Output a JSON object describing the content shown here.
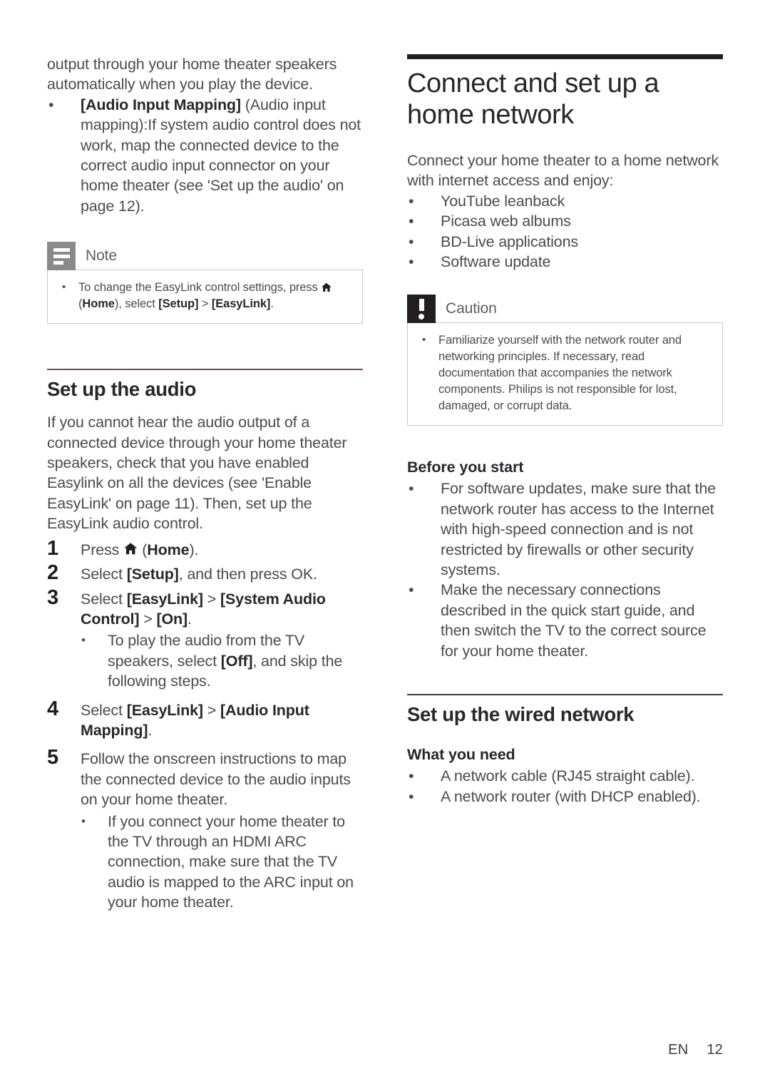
{
  "left_column": {
    "continued_paragraph": "output through your home theater speakers automatically when you play the device.",
    "bullet_audio_input_mapping": {
      "bold_label": "[Audio Input Mapping]",
      "rest": " (Audio input mapping):If system audio control does not work, map the connected device to the correct audio input connector on your home theater (see 'Set up the audio' on page 12)."
    },
    "note_box": {
      "title": "Note",
      "icon": "note-lines-icon",
      "bullet_part1": "To change the EasyLink control settings, press ",
      "bullet_icon": "home-icon",
      "bullet_part2": " (",
      "bullet_home_bold": "Home",
      "bullet_part3": "), select ",
      "bullet_setup_bold": "[Setup]",
      "bullet_part4": " > ",
      "bullet_easylink_bold": "[EasyLink]",
      "bullet_part5": "."
    },
    "section": {
      "heading": "Set up the audio",
      "intro": "If you cannot hear the audio output of a connected device through your home theater speakers, check that you have enabled Easylink on all the devices (see 'Enable EasyLink' on page 11). Then, set up the EasyLink audio control."
    },
    "steps": [
      {
        "number": "1",
        "pre": "Press ",
        "icon": "home-icon",
        "bold": "Home",
        "mid": " (",
        "post": ")."
      },
      {
        "number": "2",
        "pre": "Select ",
        "bold": "[Setup]",
        "post": ", and then press OK."
      },
      {
        "number": "3",
        "pre": "Select ",
        "bold": "[EasyLink]",
        "mid": " > ",
        "bold2": "[System Audio Control]",
        "mid2": " > ",
        "bold3": "[On]",
        "post": ".",
        "subbullet": {
          "pre": "To play the audio from the TV speakers, select ",
          "bold": "[Off]",
          "post": ", and skip the following steps."
        }
      },
      {
        "number": "4",
        "pre": "Select ",
        "bold": "[EasyLink]",
        "mid": " > ",
        "bold2": "[Audio Input Mapping]",
        "post": "."
      },
      {
        "number": "5",
        "pre": "Follow the onscreen instructions to map the connected device to the audio inputs on your home theater.",
        "subbullet": {
          "pre": "If you connect your home theater to the TV through an HDMI ARC connection, make sure that the TV audio is mapped to the ARC input on your home theater."
        }
      }
    ]
  },
  "right_column": {
    "title": "Connect and set up a home network",
    "intro": "Connect your home theater to a home network with internet access and enjoy:",
    "feature_bullets": [
      "YouTube leanback",
      "Picasa web albums",
      "BD-Live applications",
      "Software update"
    ],
    "caution_box": {
      "title": "Caution",
      "icon": "exclamation-icon",
      "bullet": "Familiarize yourself with the network router and networking principles. If necessary, read documentation that accompanies the network components. Philips is not responsible for lost, damaged, or corrupt data."
    },
    "before_you_start": {
      "heading": "Before you start",
      "bullets": [
        "For software updates, make sure that the network router has access to the Internet with high-speed connection and is not restricted by firewalls or other security systems.",
        "Make the necessary connections described in the quick start guide, and then switch the TV to the correct source for your home theater."
      ]
    },
    "wired_network": {
      "heading": "Set up the wired network",
      "subheading": "What you need",
      "bullets": [
        "A network cable (RJ45 straight cable).",
        "A network router (with DHCP enabled)."
      ]
    }
  },
  "footer": {
    "language": "EN",
    "page_number": "12"
  },
  "colors": {
    "rule_thick": "#231f20",
    "rule_thin_accent": "#6b4f4c",
    "note_icon_bg": "#8a8a8a",
    "caution_icon_bg": "#231f20",
    "body_text": "#4a4a51"
  },
  "bullet_glyph": "•"
}
